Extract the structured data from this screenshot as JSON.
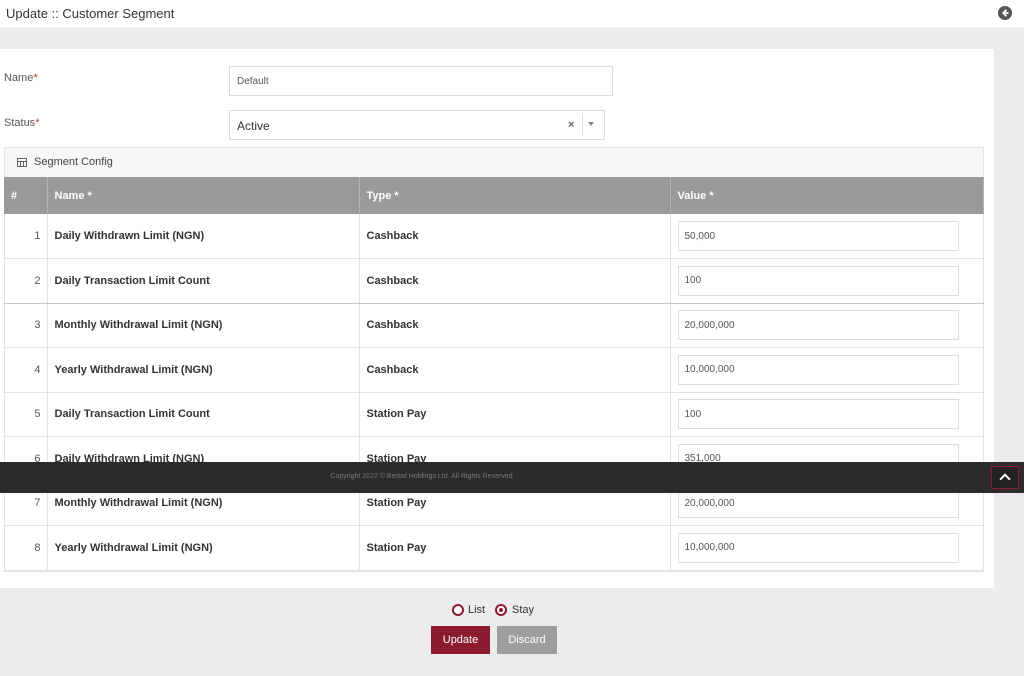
{
  "page": {
    "title": "Update :: Customer Segment"
  },
  "form": {
    "name_label": "Name",
    "name_value": "Default",
    "status_label": "Status",
    "status_value": "Active",
    "required_mark": "*",
    "clear_symbol": "×"
  },
  "config": {
    "title": "Segment Config",
    "columns": [
      "#",
      "Name *",
      "Type *",
      "Value *"
    ],
    "rows": [
      {
        "idx": "1",
        "name": "Daily Withdrawn Limit (NGN)",
        "type": "Cashback",
        "value": "50,000"
      },
      {
        "idx": "2",
        "name": "Daily Transaction Limit Count",
        "type": "Cashback",
        "value": "100"
      },
      {
        "idx": "3",
        "name": "Monthly Withdrawal Limit (NGN)",
        "type": "Cashback",
        "value": "20,000,000"
      },
      {
        "idx": "4",
        "name": "Yearly Withdrawal Limit (NGN)",
        "type": "Cashback",
        "value": "10,000,000"
      },
      {
        "idx": "5",
        "name": "Daily Transaction Limit Count",
        "type": "Station Pay",
        "value": "100"
      },
      {
        "idx": "6",
        "name": "Daily Withdrawn Limit (NGN)",
        "type": "Station Pay",
        "value": "351,000"
      },
      {
        "idx": "7",
        "name": "Monthly Withdrawal Limit (NGN)",
        "type": "Station Pay",
        "value": "20,000,000"
      },
      {
        "idx": "8",
        "name": "Yearly Withdrawal Limit (NGN)",
        "type": "Station Pay",
        "value": "10,000,000"
      }
    ]
  },
  "footer": {
    "copyright": "Copyright 2022 © Bestaf Holdings Ltd. All Rights Reserved"
  },
  "actions": {
    "radio_list": "List",
    "radio_stay": "Stay",
    "selected_mode": "Stay",
    "update_label": "Update",
    "discard_label": "Discard"
  },
  "colors": {
    "accent": "#8b1a2e",
    "header_gray": "#9a9a9a",
    "footer_dark": "#2b2b2b"
  },
  "icons": {
    "back": "circle-arrow-left-icon",
    "config": "table-icon",
    "scroll_top": "chevron-up-icon"
  }
}
